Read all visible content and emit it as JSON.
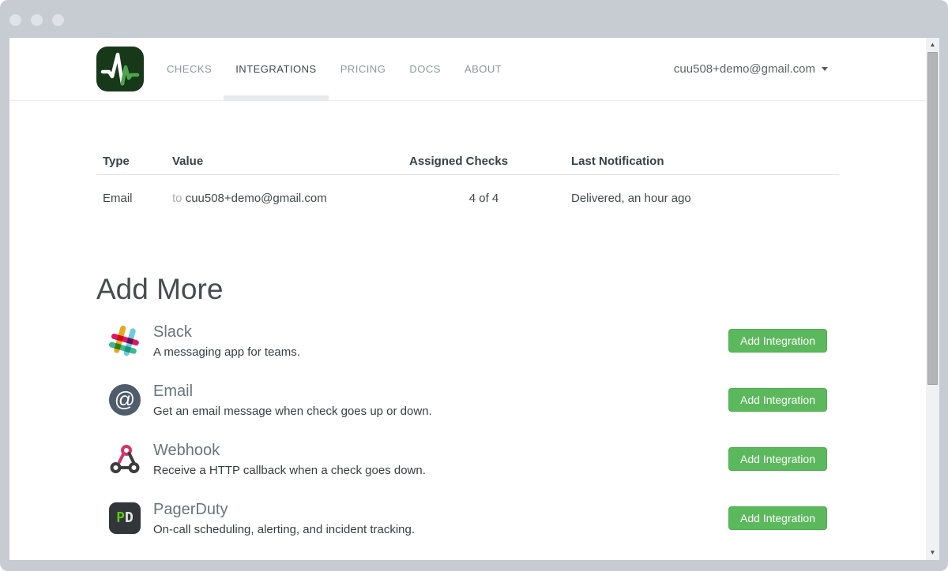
{
  "nav": {
    "items": [
      {
        "label": "CHECKS",
        "active": false
      },
      {
        "label": "INTEGRATIONS",
        "active": true
      },
      {
        "label": "PRICING",
        "active": false
      },
      {
        "label": "DOCS",
        "active": false
      },
      {
        "label": "ABOUT",
        "active": false
      }
    ],
    "account_email": "cuu508+demo@gmail.com"
  },
  "table": {
    "headers": [
      "Type",
      "Value",
      "Assigned Checks",
      "Last Notification"
    ],
    "rows": [
      {
        "type": "Email",
        "value_prefix": "to",
        "value": "cuu508+demo@gmail.com",
        "assigned_checks": "4 of 4",
        "last_notification": "Delivered, an hour ago"
      }
    ]
  },
  "add_more": {
    "heading": "Add More",
    "integrations": [
      {
        "name": "Slack",
        "description": "A messaging app for teams.",
        "icon": "slack-icon",
        "button_label": "Add Integration"
      },
      {
        "name": "Email",
        "description": "Get an email message when check goes up or down.",
        "icon": "email-icon",
        "icon_glyph": "@",
        "button_label": "Add Integration"
      },
      {
        "name": "Webhook",
        "description": "Receive a HTTP callback when a check goes down.",
        "icon": "webhook-icon",
        "button_label": "Add Integration"
      },
      {
        "name": "PagerDuty",
        "description": "On-call scheduling, alerting, and incident tracking.",
        "icon": "pagerduty-icon",
        "icon_text_p": "P",
        "icon_text_d": "D",
        "button_label": "Add Integration"
      }
    ]
  },
  "colors": {
    "accent_green": "#5cb85c",
    "accent_green_border": "#4cae4c",
    "logo_green": "#17391a",
    "chrome_gray": "#c7cbd2"
  }
}
